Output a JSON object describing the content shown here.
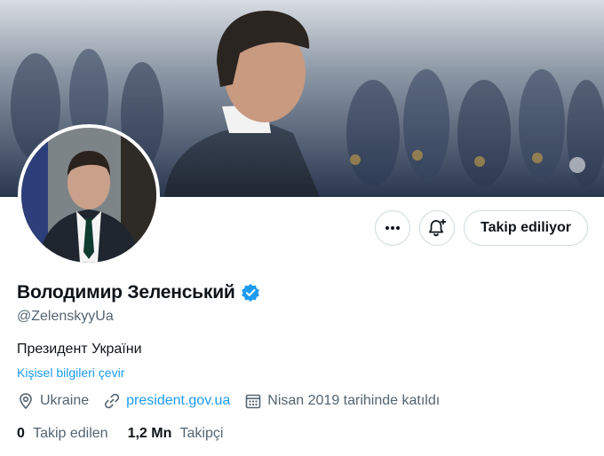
{
  "colors": {
    "accent": "#1d9bf0",
    "text": "#0f1419",
    "muted": "#536471",
    "border": "#cfd9de",
    "verified": "#1d9bf0"
  },
  "icons": {
    "more": "more-horizontal-icon",
    "notifications": "bell-plus-icon",
    "verified": "verified-badge-icon",
    "location": "map-pin-icon",
    "link": "link-icon",
    "joined": "calendar-icon"
  },
  "header": {
    "follow_button_label": "Takip ediliyor"
  },
  "profile": {
    "display_name": "Володимир Зеленський",
    "handle": "@ZelenskyyUa",
    "bio": "Президент України",
    "translate_label": "Kişisel bilgileri çevir",
    "location": "Ukraine",
    "website": "president.gov.ua",
    "joined": "Nisan 2019 tarihinde katıldı"
  },
  "stats": {
    "following_count": "0",
    "following_label": "Takip edilen",
    "followers_count": "1,2 Mn",
    "followers_label": "Takipçi"
  }
}
